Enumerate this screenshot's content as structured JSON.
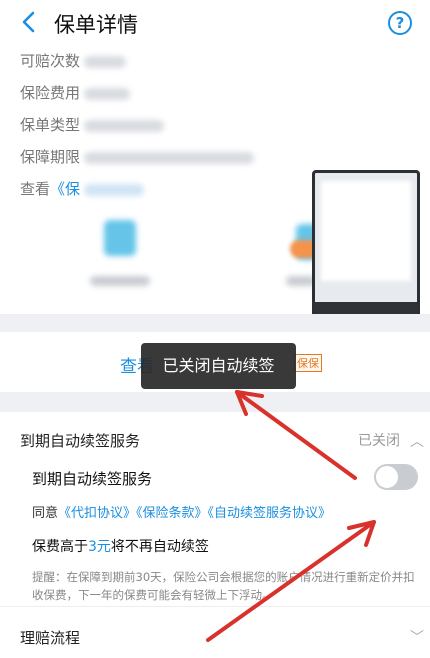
{
  "nav": {
    "title": "保单详情",
    "help_icon": "question-circle-icon",
    "back_icon": "chevron-left-icon"
  },
  "info": {
    "rows": [
      {
        "label": "可赔次数"
      },
      {
        "label": "保险费用"
      },
      {
        "label": "保单类型"
      },
      {
        "label": "保障期限"
      }
    ],
    "view_prefix": "查看",
    "view_link": "《保"
  },
  "view": {
    "link_prefix": "查看",
    "stamp": "保保"
  },
  "toast": {
    "text": "已关闭自动续签"
  },
  "auto": {
    "header": "到期自动续签服务",
    "status": "已关闭",
    "caret": "︿",
    "switch_label": "到期自动续签服务",
    "switch_on": false,
    "agree_prefix": "同意",
    "agreements": [
      "《代扣协议》",
      "《保险条款》",
      "《自动续签服务协议》"
    ],
    "fee_prefix": "保费高于",
    "fee_amount": "3元",
    "fee_suffix": "将不再自动续签",
    "tip": "提醒：在保障到期前30天，保险公司会根据您的账户情况进行重新定价并扣收保费，下一年的保费可能会有轻微上下浮动。"
  },
  "claim": {
    "title": "理赔流程",
    "caret": "﹀"
  },
  "colors": {
    "accent": "#1a8fe0",
    "arrow": "#d9312b"
  }
}
